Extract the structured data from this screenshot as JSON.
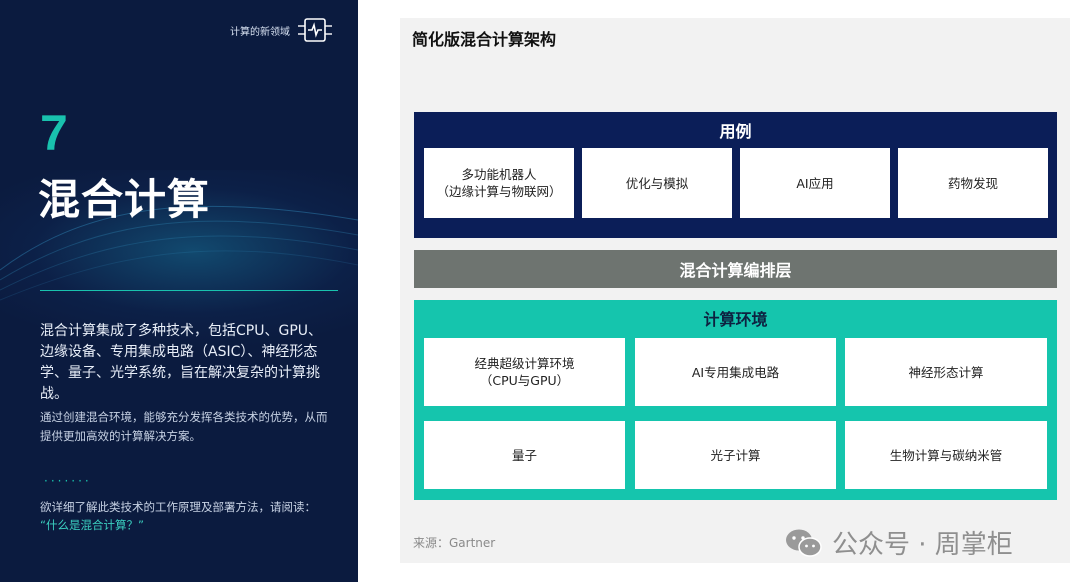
{
  "left_panel": {
    "brand_text": "计算的新领域",
    "chapter_number": "7",
    "chapter_title": "混合计算",
    "intro": "混合计算集成了多种技术，包括CPU、GPU、边缘设备、专用集成电路（ASIC）、神经形态学、量子、光学系统，旨在解决复杂的计算挑战。",
    "intro2": "通过创建混合环境，能够充分发挥各类技术的优势，从而提供更加高效的计算解决方案。",
    "dots": "·······",
    "read_more_prefix": "欲详细了解此类技术的工作原理及部署方法，请阅读：",
    "read_more_link": "“什么是混合计算？”"
  },
  "diagram": {
    "title": "简化版混合计算架构",
    "use_cases": {
      "heading": "用例",
      "items": [
        {
          "line1": "多功能机器人",
          "line2": "（边缘计算与物联网）"
        },
        {
          "line1": "优化与模拟",
          "line2": ""
        },
        {
          "line1": "AI应用",
          "line2": ""
        },
        {
          "line1": "药物发现",
          "line2": ""
        }
      ]
    },
    "orchestration": "混合计算编排层",
    "environment": {
      "heading": "计算环境",
      "items": [
        {
          "line1": "经典超级计算环境",
          "line2": "（CPU与GPU）"
        },
        {
          "line1": "AI专用集成电路",
          "line2": ""
        },
        {
          "line1": "神经形态计算",
          "line2": ""
        },
        {
          "line1": "量子",
          "line2": ""
        },
        {
          "line1": "光子计算",
          "line2": ""
        },
        {
          "line1": "生物计算与碳纳米管",
          "line2": ""
        }
      ]
    },
    "source": "来源：Gartner"
  },
  "watermark": "公众号 · 周掌柜",
  "colors": {
    "left_bg": "#0b1b3f",
    "accent_teal": "#19c2ae",
    "usecase_bg": "#0b1e58",
    "orchestration_bg": "#6e7470",
    "environment_bg": "#15c5ad"
  }
}
